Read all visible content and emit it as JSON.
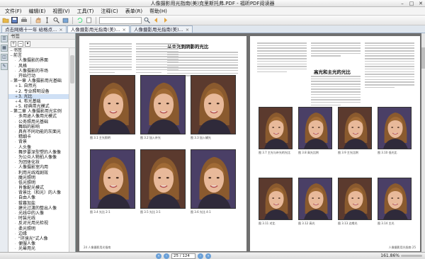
{
  "window": {
    "title": "人像摄影用光指南(美)克里斯托弗.PDF - 福昕PDF阅读器",
    "minimize": "–",
    "maximize": "□",
    "close": "✕"
  },
  "menu": [
    "文件(F)",
    "编辑(E)",
    "视图(V)",
    "工具(T)",
    "注释(C)",
    "表单(R)",
    "帮助(H)"
  ],
  "toolbar": {
    "icons": [
      "open-icon",
      "save-icon",
      "print-icon",
      "hand-tool-icon",
      "select-text-icon",
      "zoom-icon",
      "snapshot-icon",
      "search-icon",
      "find-prev-icon",
      "find-next-icon"
    ],
    "search_placeholder": ""
  },
  "tabs": [
    {
      "label": "点击网络十一年 给格点..."
    },
    {
      "label": "人像摄影用光指南(美)..."
    },
    {
      "label": "人像摄影用光指南(美)..."
    }
  ],
  "sidebar": {
    "title": "书签",
    "tree": [
      {
        "label": "书签",
        "level": 0,
        "tw": "−"
      },
      {
        "label": "前言",
        "level": 0,
        "tw": "−"
      },
      {
        "label": "人像摄影的界面",
        "level": 1
      },
      {
        "label": "风格",
        "level": 1
      },
      {
        "label": "人像摄影的市场",
        "level": 1
      },
      {
        "label": "开始行动",
        "level": 1
      },
      {
        "label": "第一章 人像摄影用光基础",
        "level": 0,
        "tw": "−"
      },
      {
        "label": "1. 自然光",
        "level": 1,
        "tw": "+"
      },
      {
        "label": "2. 专业照明设备",
        "level": 1,
        "tw": "+"
      },
      {
        "label": "3. 光比",
        "level": 1,
        "tw": "+",
        "selected": true
      },
      {
        "label": "4. 布光基础",
        "level": 1,
        "tw": "+"
      },
      {
        "label": "5. 经典用光模式",
        "level": 1,
        "tw": "+"
      },
      {
        "label": "第二章 人像摄影用光实例",
        "level": 0,
        "tw": "−"
      },
      {
        "label": "多用途人像用光模式",
        "level": 1
      },
      {
        "label": "公务照用光基础",
        "level": 1
      },
      {
        "label": "舞蹈的影响",
        "level": 1
      },
      {
        "label": "具有不同功能的灰面光",
        "level": 1
      },
      {
        "label": "精细卡",
        "level": 1
      },
      {
        "label": "背景",
        "level": 1
      },
      {
        "label": "人头像",
        "level": 1
      },
      {
        "label": "舞步要深型塑的人像像",
        "level": 1
      },
      {
        "label": "为公众人物拍人像像",
        "level": 1
      },
      {
        "label": "为团体化妆",
        "level": 1
      },
      {
        "label": "人像摄影室内用",
        "level": 1
      },
      {
        "label": "利用光线戏剧效",
        "level": 1
      },
      {
        "label": "魔光照明",
        "level": 1
      },
      {
        "label": "低光照明",
        "level": 1
      },
      {
        "label": "肖像配光模式",
        "level": 1
      },
      {
        "label": "背景比（和光）的人像",
        "level": 1
      },
      {
        "label": "自由人像",
        "level": 1
      },
      {
        "label": "拔暮加盐",
        "level": 1
      },
      {
        "label": "建光过渡的整出人像",
        "level": 1
      },
      {
        "label": "光线中的入像",
        "level": 1
      },
      {
        "label": "时装光线",
        "level": 1
      },
      {
        "label": "反对光用光检视",
        "level": 1
      },
      {
        "label": "柔光照明",
        "level": 1
      },
      {
        "label": "边缘",
        "level": 1
      },
      {
        "label": "\"环境光\"式人像",
        "level": 1
      },
      {
        "label": "便服人像",
        "level": 1
      },
      {
        "label": "光晕用光",
        "level": 1
      }
    ]
  },
  "document": {
    "left_page": {
      "heading": "从主光到阴影的光比",
      "captions": [
        "图 3.1 主光照明",
        "图 3.2 加入补光",
        "图 3.3 加入辅光",
        "图 3.4 光比 2:1",
        "图 3.5 光比 3:1",
        "图 3.6 光比 4:1"
      ],
      "footer": "24 人像摄影用光指南"
    },
    "right_page": {
      "heading": "高光和主光的光比",
      "captions": [
        "图 3.7 主光与补光的光比",
        "图 3.8 高光比例",
        "图 3.9 主光比例",
        "图 3.10 低光比",
        "图 3.11 对比",
        "图 3.12 高光",
        "图 3.13 边缘光",
        "图 3.14 主光"
      ],
      "footer": "人像摄影用光指南 25"
    }
  },
  "status": {
    "page_box": "25 / 124",
    "zoom": "161.86%"
  },
  "colors": {
    "viewer_bg": "#6f6f6f",
    "selection": "#cfe0f5",
    "photo_bg": "#5b3a2e",
    "tab_bar": "#dfe6ee"
  }
}
